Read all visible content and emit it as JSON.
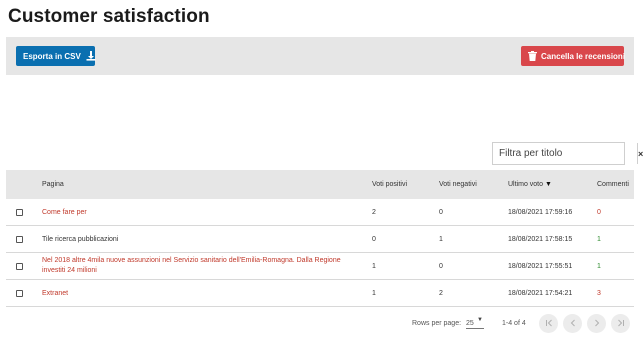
{
  "page": {
    "title": "Customer satisfaction"
  },
  "toolbar": {
    "export_label": "Esporta in CSV",
    "delete_label": "Cancella le recensioni"
  },
  "filter": {
    "placeholder": "Filtra per titolo",
    "clear_label": "×"
  },
  "table": {
    "columns": {
      "page": "Pagina",
      "positive": "Voti positivi",
      "negative": "Voti negativi",
      "last_vote": "Ultimo voto",
      "comments": "Commenti"
    },
    "sort_indicator": "▼",
    "rows": [
      {
        "title": "Come fare per",
        "positive": "2",
        "negative": "0",
        "last_vote": "18/08/2021 17:59:16",
        "comments": "0"
      },
      {
        "title": "Tile ricerca pubblicazioni",
        "positive": "0",
        "negative": "1",
        "last_vote": "18/08/2021 17:58:15",
        "comments": "1"
      },
      {
        "title": "Nel 2018 altre 4mila nuove assunzioni nel Servizio sanitario dell'Emilia-Romagna. Dalla Regione investiti 24 milioni",
        "positive": "1",
        "negative": "0",
        "last_vote": "18/08/2021 17:55:51",
        "comments": "1"
      },
      {
        "title": "Extranet",
        "positive": "1",
        "negative": "2",
        "last_vote": "18/08/2021 17:54:21",
        "comments": "3"
      }
    ]
  },
  "pagination": {
    "rows_per_page_label": "Rows per page:",
    "rows_per_page_value": "25",
    "range": "1-4 of 4"
  },
  "colors": {
    "export_button": "#0a6fb0",
    "delete_button": "#d9474b",
    "link": "#c0392b",
    "toolbar_bg": "#e6e6e6"
  }
}
